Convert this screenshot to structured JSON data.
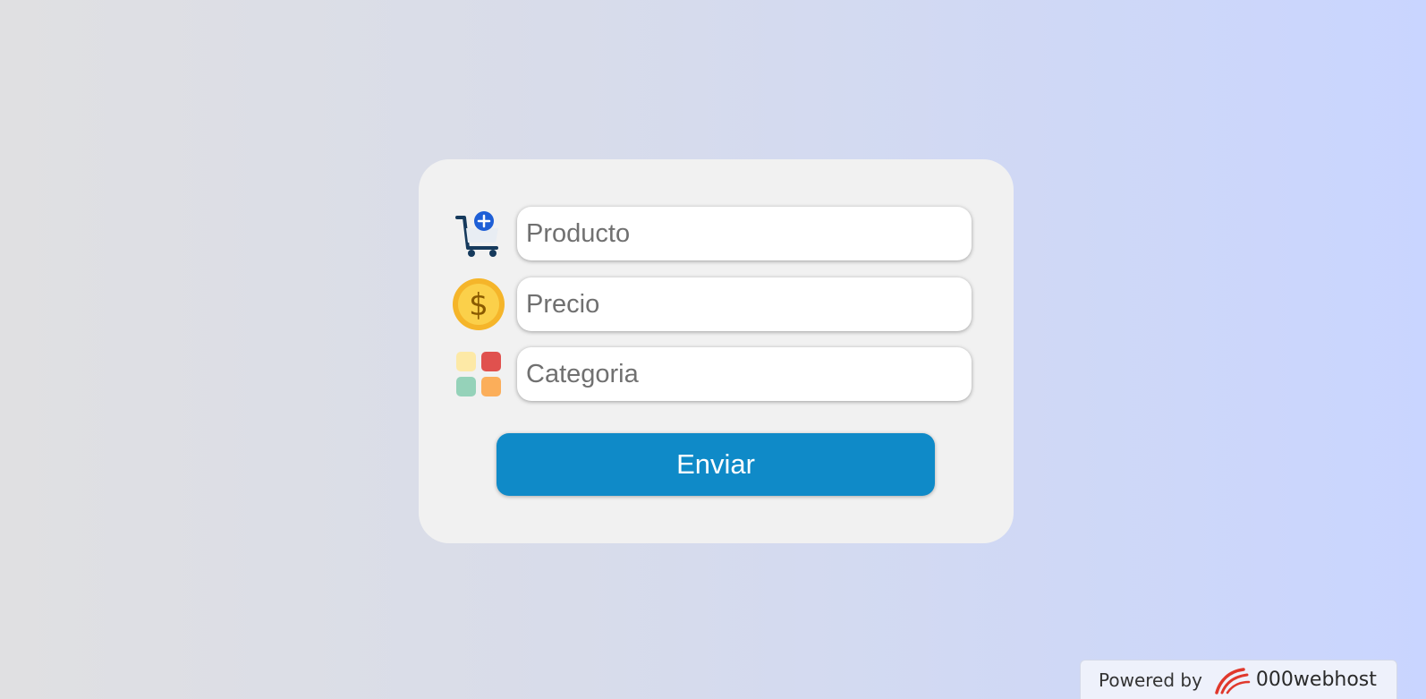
{
  "form": {
    "product": {
      "placeholder": "Producto",
      "icon": "cart-add-icon"
    },
    "price": {
      "placeholder": "Precio",
      "icon": "dollar-coin-icon"
    },
    "category": {
      "placeholder": "Categoria",
      "icon": "category-grid-icon"
    },
    "submit_label": "Enviar"
  },
  "footer": {
    "powered_by": "Powered by",
    "brand": "000webhost",
    "logo_icon": "webhost-swirl-logo"
  },
  "colors": {
    "button": "#0f8ac8",
    "card": "#f1f1f1",
    "coin": "#f6c230",
    "cart_badge": "#1e5fd6"
  }
}
